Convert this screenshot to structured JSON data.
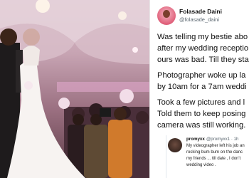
{
  "tweet": {
    "author": {
      "name": "Folasade Daini",
      "handle": "@folasade_daini"
    },
    "paragraphs": [
      [
        "Was telling my bestie abo",
        "after my wedding receptio",
        "ours was bad. Till they sta"
      ],
      [
        "Photographer woke up la",
        "by 10am for a 7am weddi"
      ],
      [
        "Took a few pictures and l",
        "Told them to keep posing",
        "camera was still working."
      ]
    ]
  },
  "reply": {
    "name": "promyxx",
    "handle": "@promyxx1 · 1h",
    "lines": [
      "My videographer left his job an",
      "rocking bum bum on the danc",
      "my friends ... till date , I don't",
      "wedding video ."
    ]
  },
  "colors": {
    "name": "#111111",
    "handle": "#5b6770",
    "body": "#111111",
    "avatar": "#e0607a"
  },
  "photo": {
    "icons": [
      "wedding-photo"
    ]
  }
}
